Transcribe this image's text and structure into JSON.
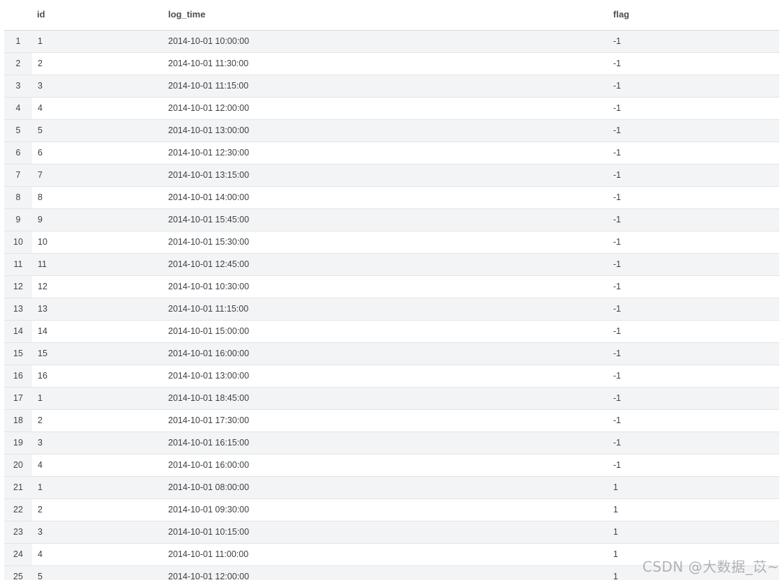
{
  "table": {
    "columns": {
      "id": "id",
      "log_time": "log_time",
      "flag": "flag"
    },
    "rows": [
      {
        "num": "1",
        "id": "1",
        "log_time": "2014-10-01 10:00:00",
        "flag": "-1"
      },
      {
        "num": "2",
        "id": "2",
        "log_time": "2014-10-01 11:30:00",
        "flag": "-1"
      },
      {
        "num": "3",
        "id": "3",
        "log_time": "2014-10-01 11:15:00",
        "flag": "-1"
      },
      {
        "num": "4",
        "id": "4",
        "log_time": "2014-10-01 12:00:00",
        "flag": "-1"
      },
      {
        "num": "5",
        "id": "5",
        "log_time": "2014-10-01 13:00:00",
        "flag": "-1"
      },
      {
        "num": "6",
        "id": "6",
        "log_time": "2014-10-01 12:30:00",
        "flag": "-1"
      },
      {
        "num": "7",
        "id": "7",
        "log_time": "2014-10-01 13:15:00",
        "flag": "-1"
      },
      {
        "num": "8",
        "id": "8",
        "log_time": "2014-10-01 14:00:00",
        "flag": "-1"
      },
      {
        "num": "9",
        "id": "9",
        "log_time": "2014-10-01 15:45:00",
        "flag": "-1"
      },
      {
        "num": "10",
        "id": "10",
        "log_time": "2014-10-01 15:30:00",
        "flag": "-1"
      },
      {
        "num": "11",
        "id": "11",
        "log_time": "2014-10-01 12:45:00",
        "flag": "-1"
      },
      {
        "num": "12",
        "id": "12",
        "log_time": "2014-10-01 10:30:00",
        "flag": "-1"
      },
      {
        "num": "13",
        "id": "13",
        "log_time": "2014-10-01 11:15:00",
        "flag": "-1"
      },
      {
        "num": "14",
        "id": "14",
        "log_time": "2014-10-01 15:00:00",
        "flag": "-1"
      },
      {
        "num": "15",
        "id": "15",
        "log_time": "2014-10-01 16:00:00",
        "flag": "-1"
      },
      {
        "num": "16",
        "id": "16",
        "log_time": "2014-10-01 13:00:00",
        "flag": "-1"
      },
      {
        "num": "17",
        "id": "1",
        "log_time": "2014-10-01 18:45:00",
        "flag": "-1"
      },
      {
        "num": "18",
        "id": "2",
        "log_time": "2014-10-01 17:30:00",
        "flag": "-1"
      },
      {
        "num": "19",
        "id": "3",
        "log_time": "2014-10-01 16:15:00",
        "flag": "-1"
      },
      {
        "num": "20",
        "id": "4",
        "log_time": "2014-10-01 16:00:00",
        "flag": "-1"
      },
      {
        "num": "21",
        "id": "1",
        "log_time": "2014-10-01 08:00:00",
        "flag": "1"
      },
      {
        "num": "22",
        "id": "2",
        "log_time": "2014-10-01 09:30:00",
        "flag": "1"
      },
      {
        "num": "23",
        "id": "3",
        "log_time": "2014-10-01 10:15:00",
        "flag": "1"
      },
      {
        "num": "24",
        "id": "4",
        "log_time": "2014-10-01 11:00:00",
        "flag": "1"
      },
      {
        "num": "25",
        "id": "5",
        "log_time": "2014-10-01 12:00:00",
        "flag": "1"
      }
    ]
  },
  "watermark": "CSDN @大数据_苡~",
  "colors": {
    "accent": "#2b7cb4",
    "stripe": "#f3f4f6",
    "border": "#e1e4e8"
  }
}
